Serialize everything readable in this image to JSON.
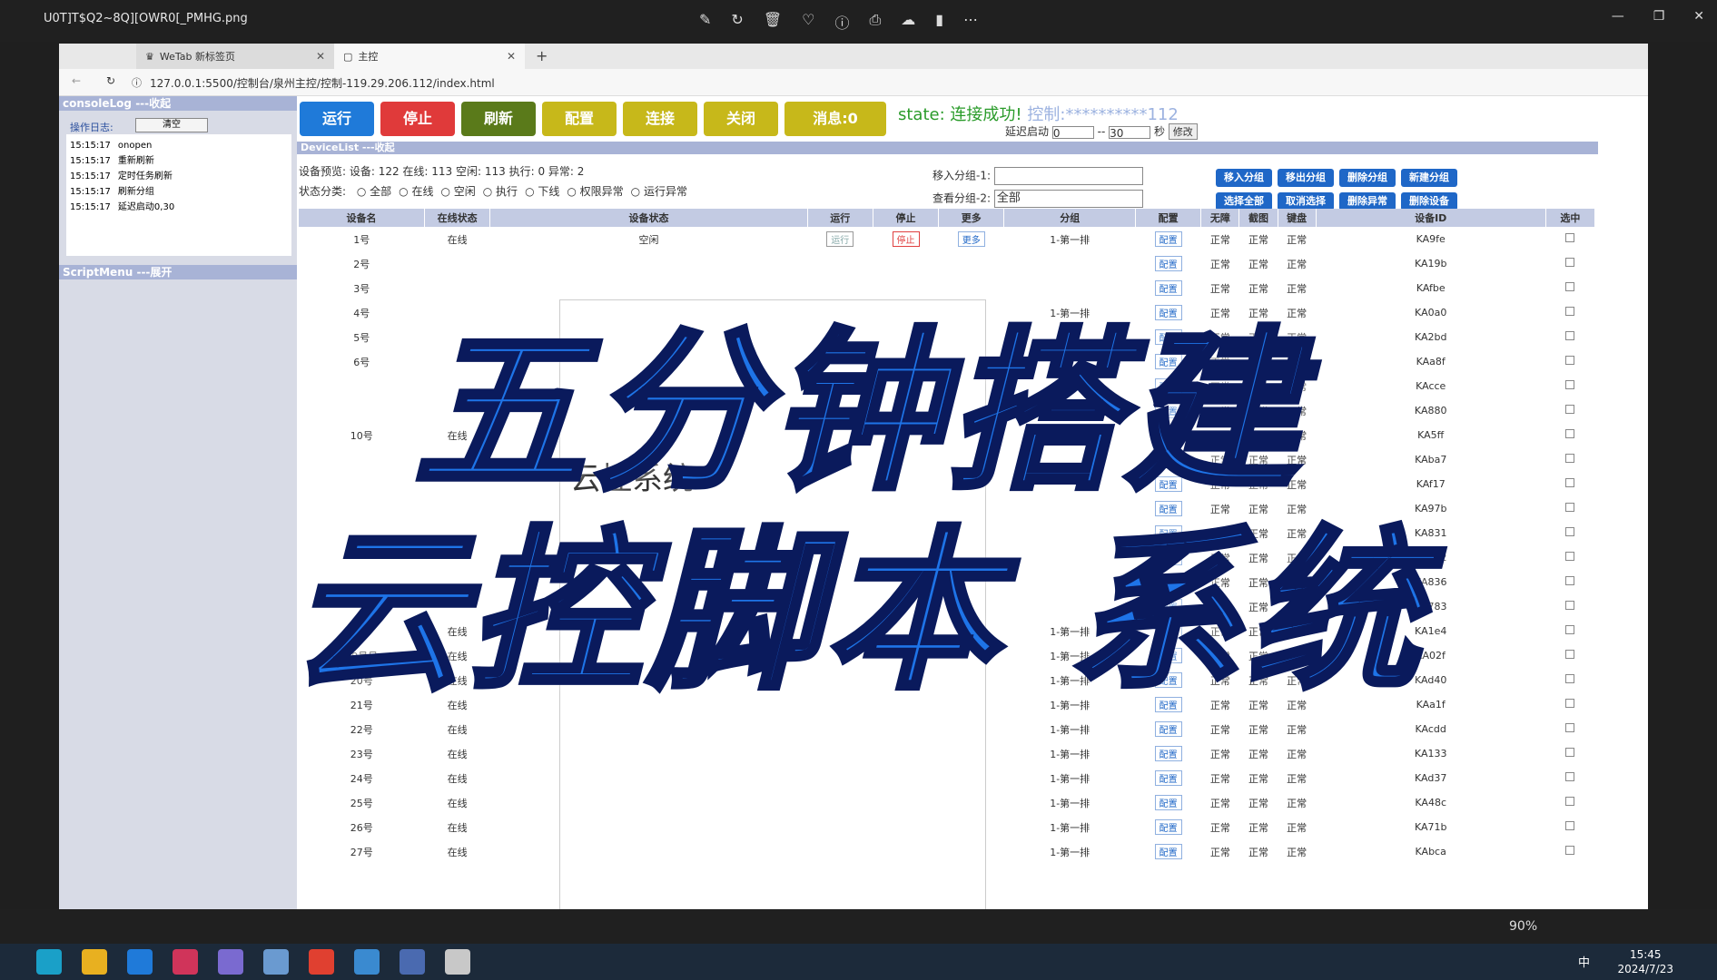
{
  "viewer": {
    "file_name": "U0T]T$Q2~8Q][OWR0[_PMHG.png",
    "zoom": "90%",
    "tools": [
      "edit-icon",
      "rotate-icon",
      "delete-icon",
      "heart-icon",
      "info-icon",
      "print-icon",
      "cloud-icon",
      "video-icon",
      "more-icon"
    ]
  },
  "browser": {
    "tabs": [
      {
        "label": "WeTab 新标签页"
      },
      {
        "label": "主控"
      }
    ],
    "url": "127.0.0.1:5500/控制台/泉州主控/控制-119.29.206.112/index.html"
  },
  "console": {
    "header": "consoleLog ---收起",
    "log_label": "操作日志:",
    "clear_label": "清空",
    "logs": [
      {
        "time": "15:15:17",
        "text": "onopen"
      },
      {
        "time": "15:15:17",
        "text": "重新刷新"
      },
      {
        "time": "15:15:17",
        "text": "定时任务刷新"
      },
      {
        "time": "15:15:17",
        "text": "刷新分组"
      },
      {
        "time": "15:15:17",
        "text": "延迟启动0,30"
      }
    ],
    "script_menu": "ScriptMenu ---展开"
  },
  "controls": {
    "buttons": [
      {
        "label": "运行",
        "color": "#1f7ad9"
      },
      {
        "label": "停止",
        "color": "#e03a3a"
      },
      {
        "label": "刷新",
        "color": "#5a7a1a"
      },
      {
        "label": "配置",
        "color": "#c7b81a"
      },
      {
        "label": "连接",
        "color": "#c7b81a"
      },
      {
        "label": "关闭",
        "color": "#c7b81a"
      },
      {
        "label": "消息:0",
        "color": "#c7b81a"
      }
    ],
    "state_label": "state:",
    "state_value": "连接成功!",
    "control_label": "控制:",
    "control_ip": "**********112",
    "delay_label": "延迟启动",
    "delay_from": "0",
    "delay_to": "30",
    "delay_unit": "秒",
    "modify_label": "修改"
  },
  "devicelist": {
    "header": "DeviceList ---收起",
    "stats": "设备预览: 设备: 122 在线: 113 空闲: 113 执行: 0 异常: 2",
    "filter_label": "状态分类:",
    "filters": [
      "全部",
      "在线",
      "空闲",
      "执行",
      "下线",
      "权限异常",
      "运行异常"
    ],
    "group1_label": "移入分组-1:",
    "group2_label": "查看分组-2:",
    "group2_value": "全部",
    "group_buttons_row1": [
      "移入分组",
      "移出分组",
      "删除分组",
      "新建分组"
    ],
    "group_buttons_row2": [
      "选择全部",
      "取消选择",
      "删除异常",
      "删除设备"
    ],
    "columns": [
      "设备名",
      "在线状态",
      "设备状态",
      "运行",
      "停止",
      "更多",
      "分组",
      "配置",
      "无障",
      "截图",
      "键盘",
      "设备ID",
      "选中"
    ],
    "rows": [
      {
        "name": "1号",
        "online": "在线",
        "status": "空闲",
        "group": "1-第一排",
        "id": "KA9fe"
      },
      {
        "name": "2号",
        "online": "",
        "status": "",
        "group": "",
        "id": "KA19b"
      },
      {
        "name": "3号",
        "online": "",
        "status": "",
        "group": "",
        "id": "KAfbe"
      },
      {
        "name": "4号",
        "online": "",
        "status": "",
        "group": "1-第一排",
        "id": "KA0a0"
      },
      {
        "name": "5号",
        "online": "",
        "status": "",
        "group": "",
        "id": "KA2bd"
      },
      {
        "name": "6号",
        "online": "",
        "status": "",
        "group": "",
        "id": "KAa8f"
      },
      {
        "name": "",
        "online": "",
        "status": "",
        "group": "",
        "id": "KAcce"
      },
      {
        "name": "",
        "online": "",
        "status": "",
        "group": "",
        "id": "KA880"
      },
      {
        "name": "10号",
        "online": "在线",
        "status": "",
        "group": "1-第一排",
        "id": "KA5ff"
      },
      {
        "name": "",
        "online": "",
        "status": "",
        "group": "",
        "id": "KAba7"
      },
      {
        "name": "",
        "online": "",
        "status": "",
        "group": "",
        "id": "KAf17"
      },
      {
        "name": "",
        "online": "",
        "status": "",
        "group": "",
        "id": "KA97b"
      },
      {
        "name": "",
        "online": "",
        "status": "",
        "group": "",
        "id": "KA831"
      },
      {
        "name": "",
        "online": "",
        "status": "",
        "group": "",
        "id": "KAb42"
      },
      {
        "name": "",
        "online": "",
        "status": "",
        "group": "",
        "id": "KA836"
      },
      {
        "name": "",
        "online": "",
        "status": "",
        "group": "",
        "id": "KA783"
      },
      {
        "name": "",
        "online": "在线",
        "status": "",
        "group": "1-第一排",
        "id": "KA1e4"
      },
      {
        "name": "19号号",
        "online": "在线",
        "status": "",
        "group": "1-第一排",
        "id": "KA02f"
      },
      {
        "name": "20号",
        "online": "在线",
        "status": "",
        "group": "1-第一排",
        "id": "KAd40"
      },
      {
        "name": "21号",
        "online": "在线",
        "status": "",
        "group": "1-第一排",
        "id": "KAa1f"
      },
      {
        "name": "22号",
        "online": "在线",
        "status": "",
        "group": "1-第一排",
        "id": "KAcdd"
      },
      {
        "name": "23号",
        "online": "在线",
        "status": "",
        "group": "1-第一排",
        "id": "KA133"
      },
      {
        "name": "24号",
        "online": "在线",
        "status": "",
        "group": "1-第一排",
        "id": "KAd37"
      },
      {
        "name": "25号",
        "online": "在线",
        "status": "",
        "group": "1-第一排",
        "id": "KA48c"
      },
      {
        "name": "26号",
        "online": "在线",
        "status": "",
        "group": "1-第一排",
        "id": "KA71b"
      },
      {
        "name": "27号",
        "online": "在线",
        "status": "",
        "group": "1-第一排",
        "id": "KAbca"
      }
    ],
    "run_label": "运行",
    "stop_label": "停止",
    "more_label": "更多",
    "config_label": "配置",
    "ok_label": "正常"
  },
  "overlay": {
    "line1": "五分钟搭建",
    "line2": "云控脚本 系统",
    "window_text": "云控系统"
  },
  "taskbar": {
    "time": "15:45",
    "date": "2024/7/23",
    "ime": "中"
  }
}
